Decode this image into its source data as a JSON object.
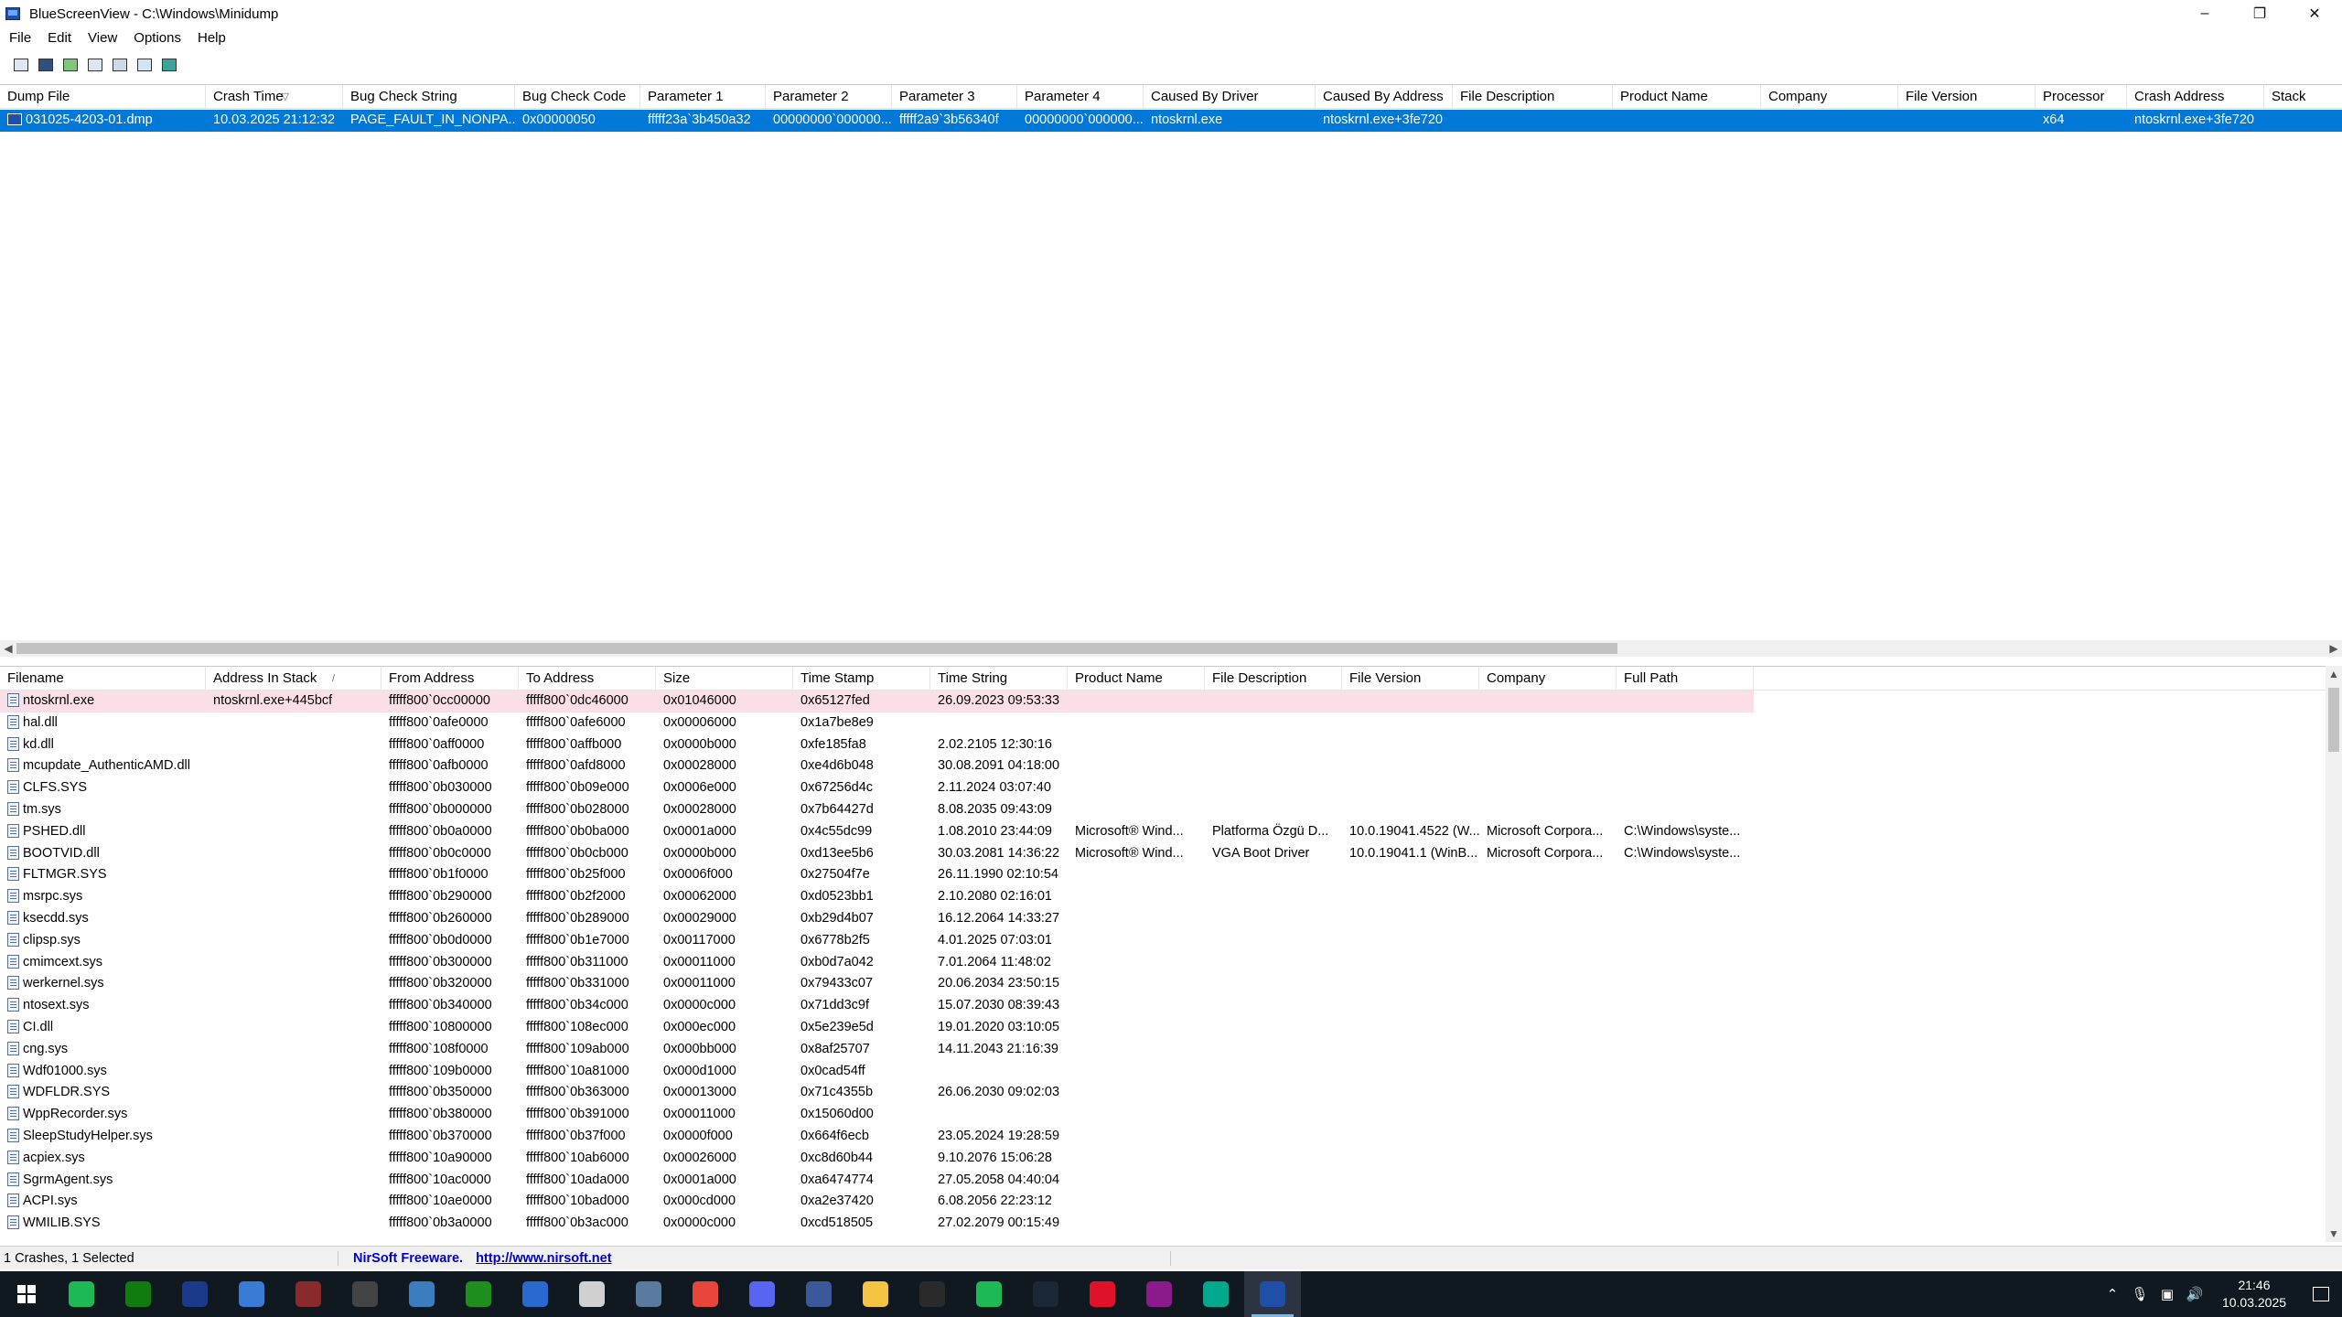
{
  "window": {
    "title": "BlueScreenView  -  C:\\Windows\\Minidump",
    "controls": {
      "minimize": "–",
      "restore": "❐",
      "close": "✕"
    }
  },
  "menu": [
    "File",
    "Edit",
    "View",
    "Options",
    "Help"
  ],
  "toolbar": [
    "properties-icon",
    "save-icon",
    "refresh-icon",
    "copy-icon",
    "html-report-icon",
    "find-icon",
    "exit-icon"
  ],
  "crash_list": {
    "columns": [
      "Dump File",
      "Crash Time",
      "Bug Check String",
      "Bug Check Code",
      "Parameter 1",
      "Parameter 2",
      "Parameter 3",
      "Parameter 4",
      "Caused By Driver",
      "Caused By Address",
      "File Description",
      "Product Name",
      "Company",
      "File Version",
      "Processor",
      "Crash Address",
      "Stack Addre"
    ],
    "sort_indicator": "▽",
    "rows": [
      [
        "031025-4203-01.dmp",
        "10.03.2025 21:12:32",
        "PAGE_FAULT_IN_NONPA...",
        "0x00000050",
        "fffff23a`3b450a32",
        "00000000`000000...",
        "fffff2a9`3b56340f",
        "00000000`000000...",
        "ntoskrnl.exe",
        "ntoskrnl.exe+3fe720",
        "",
        "",
        "",
        "",
        "x64",
        "ntoskrnl.exe+3fe720",
        ""
      ]
    ]
  },
  "driver_list": {
    "columns": [
      "Filename",
      "Address In Stack",
      "From Address",
      "To Address",
      "Size",
      "Time Stamp",
      "Time String",
      "Product Name",
      "File Description",
      "File Version",
      "Company",
      "Full Path"
    ],
    "sort_indicator": "/",
    "rows": [
      [
        "ntoskrnl.exe",
        "ntoskrnl.exe+445bcf",
        "fffff800`0cc00000",
        "fffff800`0dc46000",
        "0x01046000",
        "0x65127fed",
        "26.09.2023 09:53:33",
        "",
        "",
        "",
        "",
        ""
      ],
      [
        "hal.dll",
        "",
        "fffff800`0afe0000",
        "fffff800`0afe6000",
        "0x00006000",
        "0x1a7be8e9",
        "",
        "",
        "",
        "",
        "",
        ""
      ],
      [
        "kd.dll",
        "",
        "fffff800`0aff0000",
        "fffff800`0affb000",
        "0x0000b000",
        "0xfe185fa8",
        "2.02.2105 12:30:16",
        "",
        "",
        "",
        "",
        ""
      ],
      [
        "mcupdate_AuthenticAMD.dll",
        "",
        "fffff800`0afb0000",
        "fffff800`0afd8000",
        "0x00028000",
        "0xe4d6b048",
        "30.08.2091 04:18:00",
        "",
        "",
        "",
        "",
        ""
      ],
      [
        "CLFS.SYS",
        "",
        "fffff800`0b030000",
        "fffff800`0b09e000",
        "0x0006e000",
        "0x67256d4c",
        "2.11.2024 03:07:40",
        "",
        "",
        "",
        "",
        ""
      ],
      [
        "tm.sys",
        "",
        "fffff800`0b000000",
        "fffff800`0b028000",
        "0x00028000",
        "0x7b64427d",
        "8.08.2035 09:43:09",
        "",
        "",
        "",
        "",
        ""
      ],
      [
        "PSHED.dll",
        "",
        "fffff800`0b0a0000",
        "fffff800`0b0ba000",
        "0x0001a000",
        "0x4c55dc99",
        "1.08.2010 23:44:09",
        "Microsoft® Wind...",
        "Platforma Özgü D...",
        "10.0.19041.4522 (W...",
        "Microsoft Corpora...",
        "C:\\Windows\\syste..."
      ],
      [
        "BOOTVID.dll",
        "",
        "fffff800`0b0c0000",
        "fffff800`0b0cb000",
        "0x0000b000",
        "0xd13ee5b6",
        "30.03.2081 14:36:22",
        "Microsoft® Wind...",
        "VGA Boot Driver",
        "10.0.19041.1 (WinB...",
        "Microsoft Corpora...",
        "C:\\Windows\\syste..."
      ],
      [
        "FLTMGR.SYS",
        "",
        "fffff800`0b1f0000",
        "fffff800`0b25f000",
        "0x0006f000",
        "0x27504f7e",
        "26.11.1990 02:10:54",
        "",
        "",
        "",
        "",
        ""
      ],
      [
        "msrpc.sys",
        "",
        "fffff800`0b290000",
        "fffff800`0b2f2000",
        "0x00062000",
        "0xd0523bb1",
        "2.10.2080 02:16:01",
        "",
        "",
        "",
        "",
        ""
      ],
      [
        "ksecdd.sys",
        "",
        "fffff800`0b260000",
        "fffff800`0b289000",
        "0x00029000",
        "0xb29d4b07",
        "16.12.2064 14:33:27",
        "",
        "",
        "",
        "",
        ""
      ],
      [
        "clipsp.sys",
        "",
        "fffff800`0b0d0000",
        "fffff800`0b1e7000",
        "0x00117000",
        "0x6778b2f5",
        "4.01.2025 07:03:01",
        "",
        "",
        "",
        "",
        ""
      ],
      [
        "cmimcext.sys",
        "",
        "fffff800`0b300000",
        "fffff800`0b311000",
        "0x00011000",
        "0xb0d7a042",
        "7.01.2064 11:48:02",
        "",
        "",
        "",
        "",
        ""
      ],
      [
        "werkernel.sys",
        "",
        "fffff800`0b320000",
        "fffff800`0b331000",
        "0x00011000",
        "0x79433c07",
        "20.06.2034 23:50:15",
        "",
        "",
        "",
        "",
        ""
      ],
      [
        "ntosext.sys",
        "",
        "fffff800`0b340000",
        "fffff800`0b34c000",
        "0x0000c000",
        "0x71dd3c9f",
        "15.07.2030 08:39:43",
        "",
        "",
        "",
        "",
        ""
      ],
      [
        "CI.dll",
        "",
        "fffff800`10800000",
        "fffff800`108ec000",
        "0x000ec000",
        "0x5e239e5d",
        "19.01.2020 03:10:05",
        "",
        "",
        "",
        "",
        ""
      ],
      [
        "cng.sys",
        "",
        "fffff800`108f0000",
        "fffff800`109ab000",
        "0x000bb000",
        "0x8af25707",
        "14.11.2043 21:16:39",
        "",
        "",
        "",
        "",
        ""
      ],
      [
        "Wdf01000.sys",
        "",
        "fffff800`109b0000",
        "fffff800`10a81000",
        "0x000d1000",
        "0x0cad54ff",
        "",
        "",
        "",
        "",
        "",
        ""
      ],
      [
        "WDFLDR.SYS",
        "",
        "fffff800`0b350000",
        "fffff800`0b363000",
        "0x00013000",
        "0x71c4355b",
        "26.06.2030 09:02:03",
        "",
        "",
        "",
        "",
        ""
      ],
      [
        "WppRecorder.sys",
        "",
        "fffff800`0b380000",
        "fffff800`0b391000",
        "0x00011000",
        "0x15060d00",
        "",
        "",
        "",
        "",
        "",
        ""
      ],
      [
        "SleepStudyHelper.sys",
        "",
        "fffff800`0b370000",
        "fffff800`0b37f000",
        "0x0000f000",
        "0x664f6ecb",
        "23.05.2024 19:28:59",
        "",
        "",
        "",
        "",
        ""
      ],
      [
        "acpiex.sys",
        "",
        "fffff800`10a90000",
        "fffff800`10ab6000",
        "0x00026000",
        "0xc8d60b44",
        "9.10.2076 15:06:28",
        "",
        "",
        "",
        "",
        ""
      ],
      [
        "SgrmAgent.sys",
        "",
        "fffff800`10ac0000",
        "fffff800`10ada000",
        "0x0001a000",
        "0xa6474774",
        "27.05.2058 04:40:04",
        "",
        "",
        "",
        "",
        ""
      ],
      [
        "ACPI.sys",
        "",
        "fffff800`10ae0000",
        "fffff800`10bad000",
        "0x000cd000",
        "0xa2e37420",
        "6.08.2056 22:23:12",
        "",
        "",
        "",
        "",
        ""
      ],
      [
        "WMILIB.SYS",
        "",
        "fffff800`0b3a0000",
        "fffff800`0b3ac000",
        "0x0000c000",
        "0xcd518505",
        "27.02.2079 00:15:49",
        "",
        "",
        "",
        "",
        ""
      ]
    ]
  },
  "status": {
    "count": "1 Crashes, 1 Selected",
    "nirsoft": "NirSoft Freeware.",
    "url": "http://www.nirsoft.net"
  },
  "taskbar": {
    "apps": [
      {
        "name": "hexagon-app-icon",
        "color": "#1db954"
      },
      {
        "name": "xbox-icon",
        "color": "#107c10"
      },
      {
        "name": "media-app-icon",
        "color": "#1b3a8a"
      },
      {
        "name": "store-icon",
        "color": "#3a7bd5"
      },
      {
        "name": "app-window-icon",
        "color": "#8a2a2a"
      },
      {
        "name": "calculator-icon",
        "color": "#444444"
      },
      {
        "name": "paint-icon",
        "color": "#3b7dbf"
      },
      {
        "name": "xbox-game-icon",
        "color": "#1e8f1e"
      },
      {
        "name": "equalizer-app-icon",
        "color": "#2a6ad0"
      },
      {
        "name": "compass-app-icon",
        "color": "#d0d0d0"
      },
      {
        "name": "files-app-icon",
        "color": "#5a7aa0"
      },
      {
        "name": "chrome-icon",
        "color": "#e8453c"
      },
      {
        "name": "discord-icon",
        "color": "#5865f2"
      },
      {
        "name": "circle-app-icon",
        "color": "#3b5998"
      },
      {
        "name": "file-explorer-icon",
        "color": "#f4c542"
      },
      {
        "name": "epic-games-icon",
        "color": "#2a2a2a"
      },
      {
        "name": "spotify-icon",
        "color": "#1db954"
      },
      {
        "name": "steam-icon",
        "color": "#1b2838"
      },
      {
        "name": "opera-icon",
        "color": "#e0112b"
      },
      {
        "name": "winrar-icon",
        "color": "#8b1a8b"
      },
      {
        "name": "kaspersky-icon",
        "color": "#00a88e"
      },
      {
        "name": "bluescreenview-icon",
        "color": "#1f4fa8"
      }
    ],
    "tray_icons": [
      "chevron-up-icon",
      "mic-icon",
      "network-icon",
      "volume-icon"
    ],
    "time": "21:46",
    "date": "10.03.2025"
  }
}
